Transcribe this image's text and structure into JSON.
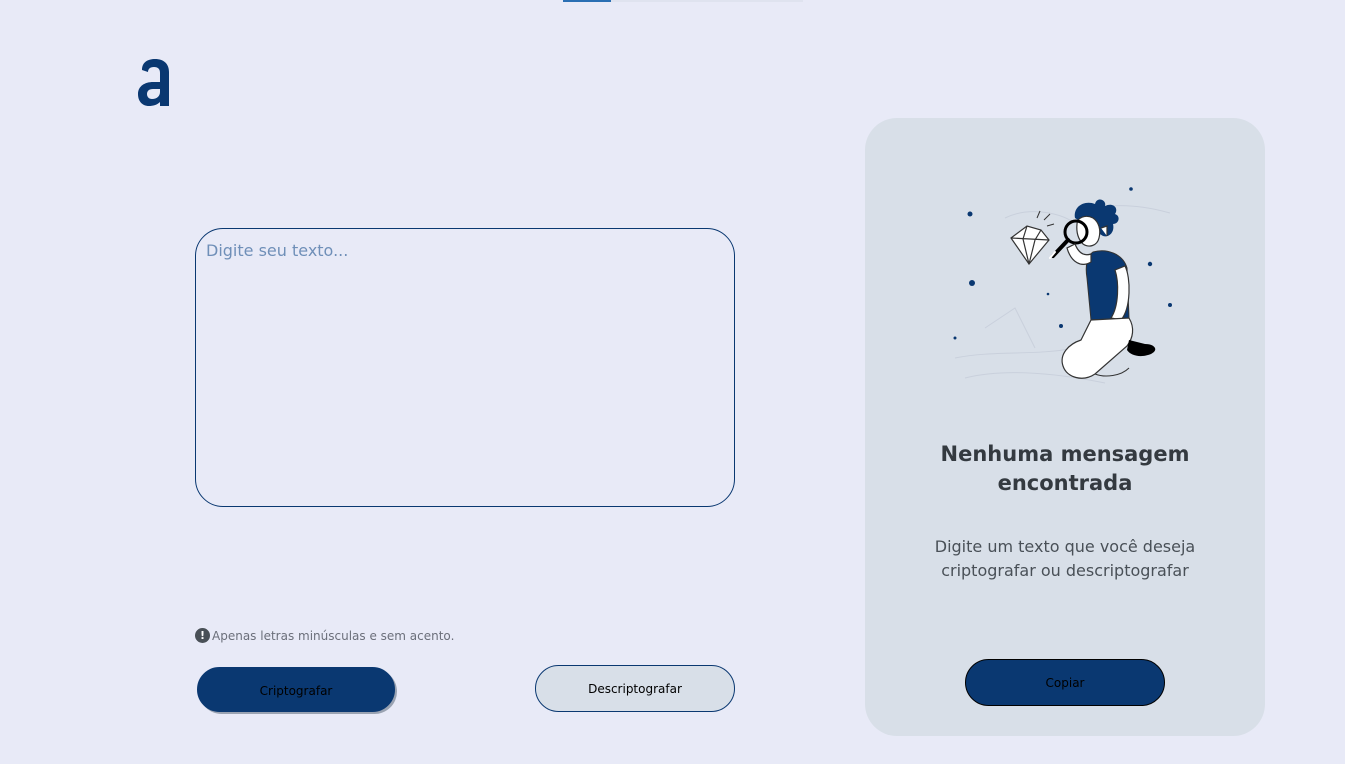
{
  "nav": {
    "active_tab_color": "#2a6fb3"
  },
  "logo": {
    "icon": "alura-a-logo",
    "letter": "a"
  },
  "input": {
    "placeholder": "Digite seu texto...",
    "value": ""
  },
  "hint": {
    "icon": "exclamation-circle-icon",
    "icon_glyph": "!",
    "text": "Apenas letras minúsculas e sem acento."
  },
  "buttons": {
    "encrypt_label": "Criptografar",
    "decrypt_label": "Descriptografar"
  },
  "output": {
    "illustration": "person-with-magnifying-glass-and-diamond",
    "title": "Nenhuma mensagem encontrada",
    "description": "Digite um texto que você deseja criptografar ou descriptografar",
    "copy_label": "Copiar"
  },
  "colors": {
    "background": "#e8eaf7",
    "primary": "#0a3871",
    "panel": "#d8dfe8",
    "text_dark": "#343a40",
    "text_muted": "#495057"
  }
}
